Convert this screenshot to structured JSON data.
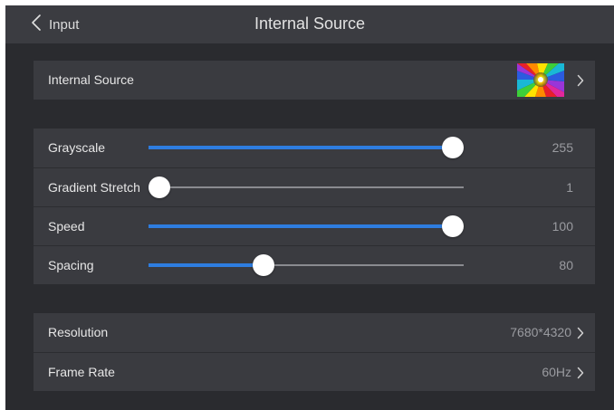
{
  "header": {
    "back_label": "Input",
    "title": "Internal Source"
  },
  "source_card": {
    "label": "Internal Source",
    "thumbnail_icon": "pattern-thumbnail-icon"
  },
  "sliders": [
    {
      "label": "Grayscale",
      "value": "255",
      "fraction": 0.965
    },
    {
      "label": "Gradient Stretch",
      "value": "1",
      "fraction": 0.035
    },
    {
      "label": "Speed",
      "value": "100",
      "fraction": 0.965
    },
    {
      "label": "Spacing",
      "value": "80",
      "fraction": 0.365
    }
  ],
  "settings": {
    "resolution": {
      "label": "Resolution",
      "value": "7680*4320"
    },
    "frame_rate": {
      "label": "Frame Rate",
      "value": "60Hz"
    }
  },
  "colors": {
    "background": "#2a2b2f",
    "titlebar": "#3b3c41",
    "card": "#3a3b40",
    "accent": "#2e7de0",
    "track": "#8a8b90",
    "knob": "#ffffff"
  }
}
